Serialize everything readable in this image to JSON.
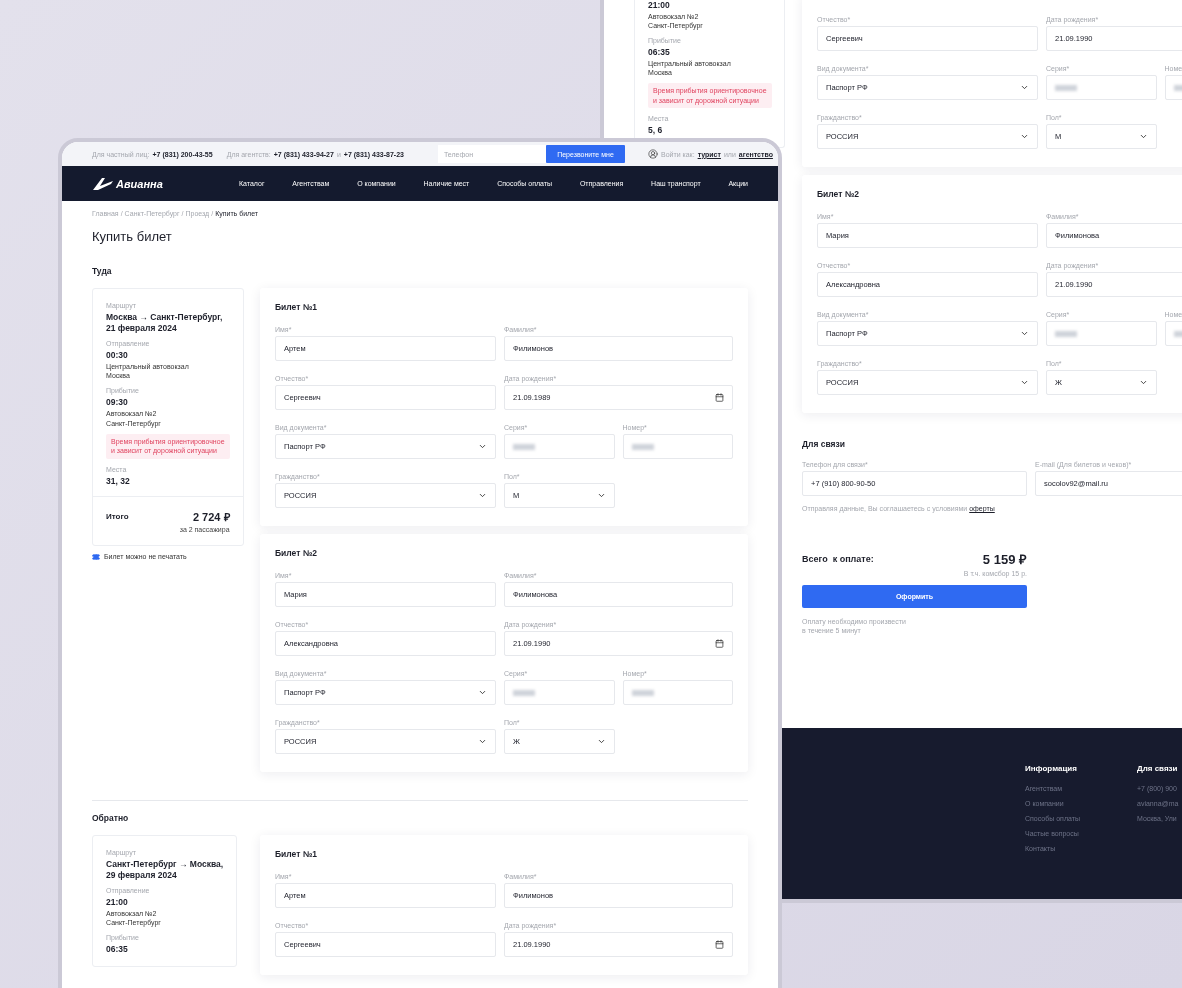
{
  "back_window": {
    "route": {
      "items": [
        {
          "kind": "value",
          "text": "21:00"
        },
        {
          "kind": "station",
          "lines": [
            "Автовокзал №2",
            "Санкт-Петербург"
          ]
        },
        {
          "kind": "label",
          "text": "Прибытие"
        },
        {
          "kind": "value",
          "text": "06:35"
        },
        {
          "kind": "station",
          "lines": [
            "Центральный автовокзал",
            "Москва"
          ]
        },
        {
          "kind": "note",
          "lines": [
            "Время прибытия ориентировочное",
            "и зависит от дорожной ситуации"
          ]
        },
        {
          "kind": "label",
          "text": "Места"
        },
        {
          "kind": "value",
          "text": "5, 6"
        }
      ]
    },
    "tickets": [
      {
        "rows": [
          [
            {
              "label": "Отчество*",
              "value": "Сергеевич",
              "kind": "text"
            },
            {
              "label": "Дата рождения*",
              "value": "21.09.1990",
              "kind": "text"
            }
          ],
          [
            {
              "label": "Вид документа*",
              "value": "Паспорт РФ",
              "kind": "select"
            },
            {
              "label": "Серия*",
              "kind": "masked"
            },
            {
              "label": "Номе",
              "kind": "masked"
            }
          ],
          [
            {
              "label": "Гражданство*",
              "value": "РОССИЯ",
              "kind": "select"
            },
            {
              "label": "Пол*",
              "value": "М",
              "kind": "select"
            }
          ]
        ]
      },
      {
        "title": "Билет №2",
        "rows": [
          [
            {
              "label": "Имя*",
              "value": "Мария",
              "kind": "text"
            },
            {
              "label": "Фамилия*",
              "value": "Филимонова",
              "kind": "text"
            }
          ],
          [
            {
              "label": "Отчество*",
              "value": "Александровна",
              "kind": "text"
            },
            {
              "label": "Дата рождения*",
              "value": "21.09.1990",
              "kind": "text"
            }
          ],
          [
            {
              "label": "Вид документа*",
              "value": "Паспорт РФ",
              "kind": "select"
            },
            {
              "label": "Серия*",
              "kind": "masked"
            },
            {
              "label": "Номе",
              "kind": "masked"
            }
          ],
          [
            {
              "label": "Гражданство*",
              "value": "РОССИЯ",
              "kind": "select"
            },
            {
              "label": "Пол*",
              "value": "Ж",
              "kind": "select"
            }
          ]
        ]
      }
    ],
    "contact": {
      "title": "Для связи",
      "fields": [
        {
          "label": "Телефон для связи*",
          "value": "+7 (910) 800-90-50"
        },
        {
          "label": "E-mail (Для билетов и чеков)*",
          "value": "socolov92@mail.ru"
        }
      ],
      "agreement": "Отправляя данные, Вы соглашаетесь с условиями ",
      "agreement_link": "оферты"
    },
    "payment": {
      "label": "Всего  к оплате:",
      "price": "5 159 ₽",
      "fee": "В т.ч. комсбор 15 р.",
      "button": "Оформить",
      "note_lines": [
        "Оплату необходимо произвести",
        "в течение 5 минут"
      ]
    },
    "footer": {
      "columns": [
        {
          "title": "Информация",
          "links": [
            "Агентствам",
            "О компании",
            "Способы оплаты",
            "Частые вопросы",
            "Контакты"
          ]
        },
        {
          "title": "Для связи",
          "links": [
            "+7 (800) 900",
            "avianna@ma",
            "Москва, Ули"
          ]
        }
      ]
    }
  },
  "front_window": {
    "topbar": {
      "private_label": "Для частный лиц:",
      "private_phone": "+7 (831) 200-43-55",
      "agency_label": "Для агентств:",
      "agency_phone_1": "+7 (831) 433-94-27",
      "and": "и",
      "agency_phone_2": "+7 (831) 433-87-23",
      "phone_placeholder": "Телефон",
      "callback_button": "Перезвоните мне",
      "login_label": "Войти как:",
      "login_tourist": "турист",
      "or": "или",
      "login_agency": "агентство"
    },
    "logo": "Авианна",
    "nav": [
      "Каталог",
      "Агентствам",
      "О компании",
      "Наличие мест",
      "Способы оплаты",
      "Отправления",
      "Наш транспорт",
      "Акции"
    ],
    "breadcrumbs": [
      "Главная",
      "Санкт-Петербург",
      "Проезд",
      "Купить билет"
    ],
    "breadcrumb_separator": "/",
    "title": "Купить билет",
    "sections": [
      {
        "title": "Туда",
        "route": {
          "items": [
            {
              "kind": "label",
              "text": "Маршрут"
            },
            {
              "kind": "heading",
              "lines": [
                "Москва → Санкт-Петербург,",
                "21 февраля 2024"
              ]
            },
            {
              "kind": "label",
              "text": "Отправление"
            },
            {
              "kind": "value",
              "text": "00:30"
            },
            {
              "kind": "station",
              "lines": [
                "Центральный автовокзал",
                "Москва"
              ]
            },
            {
              "kind": "label",
              "text": "Прибытие"
            },
            {
              "kind": "value",
              "text": "09:30"
            },
            {
              "kind": "station",
              "lines": [
                "Автовокзал №2",
                "Санкт-Петербург"
              ]
            },
            {
              "kind": "note",
              "lines": [
                "Время прибытия ориентировочное",
                "и зависит от дорожной ситуации"
              ]
            },
            {
              "kind": "label",
              "text": "Места"
            },
            {
              "kind": "value",
              "text": "31, 32"
            }
          ],
          "total": {
            "label": "Итого",
            "price": "2 724 ₽",
            "caption": "за 2 пассажира"
          }
        },
        "hint": "Билет можно не печатать",
        "tickets": [
          {
            "title": "Билет №1",
            "rows": [
              [
                {
                  "label": "Имя*",
                  "value": "Артем",
                  "kind": "text"
                },
                {
                  "label": "Фамилия*",
                  "value": "Филимонов",
                  "kind": "text"
                }
              ],
              [
                {
                  "label": "Отчество*",
                  "value": "Сергеевич",
                  "kind": "text"
                },
                {
                  "label": "Дата рождения*",
                  "value": "21.09.1989",
                  "kind": "date"
                }
              ],
              [
                {
                  "label": "Вид документа*",
                  "value": "Паспорт РФ",
                  "kind": "select"
                },
                {
                  "label": "Серия*",
                  "kind": "masked"
                },
                {
                  "label": "Номер*",
                  "kind": "masked"
                }
              ],
              [
                {
                  "label": "Гражданство*",
                  "value": "РОССИЯ",
                  "kind": "select"
                },
                {
                  "label": "Пол*",
                  "value": "М",
                  "kind": "select"
                }
              ]
            ]
          },
          {
            "title": "Билет №2",
            "rows": [
              [
                {
                  "label": "Имя*",
                  "value": "Мария",
                  "kind": "text"
                },
                {
                  "label": "Фамилия*",
                  "value": "Филимонова",
                  "kind": "text"
                }
              ],
              [
                {
                  "label": "Отчество*",
                  "value": "Александровна",
                  "kind": "text"
                },
                {
                  "label": "Дата рождения*",
                  "value": "21.09.1990",
                  "kind": "date"
                }
              ],
              [
                {
                  "label": "Вид документа*",
                  "value": "Паспорт РФ",
                  "kind": "select"
                },
                {
                  "label": "Серия*",
                  "kind": "masked"
                },
                {
                  "label": "Номер*",
                  "kind": "masked"
                }
              ],
              [
                {
                  "label": "Гражданство*",
                  "value": "РОССИЯ",
                  "kind": "select"
                },
                {
                  "label": "Пол*",
                  "value": "Ж",
                  "kind": "select"
                }
              ]
            ]
          }
        ]
      },
      {
        "title": "Обратно",
        "route": {
          "items": [
            {
              "kind": "label",
              "text": "Маршрут"
            },
            {
              "kind": "heading",
              "lines": [
                "Санкт-Петербург → Москва,",
                "29 февраля 2024"
              ]
            },
            {
              "kind": "label",
              "text": "Отправление"
            },
            {
              "kind": "value",
              "text": "21:00"
            },
            {
              "kind": "station",
              "lines": [
                "Автовокзал №2",
                "Санкт-Петербург"
              ]
            },
            {
              "kind": "label",
              "text": "Прибытие"
            },
            {
              "kind": "value",
              "text": "06:35"
            }
          ]
        },
        "tickets": [
          {
            "title": "Билет №1",
            "rows": [
              [
                {
                  "label": "Имя*",
                  "value": "Артем",
                  "kind": "text"
                },
                {
                  "label": "Фамилия*",
                  "value": "Филимонов",
                  "kind": "text"
                }
              ],
              [
                {
                  "label": "Отчество*",
                  "value": "Сергеевич",
                  "kind": "text"
                },
                {
                  "label": "Дата рождения*",
                  "value": "21.09.1990",
                  "kind": "date"
                }
              ]
            ]
          }
        ]
      }
    ]
  }
}
